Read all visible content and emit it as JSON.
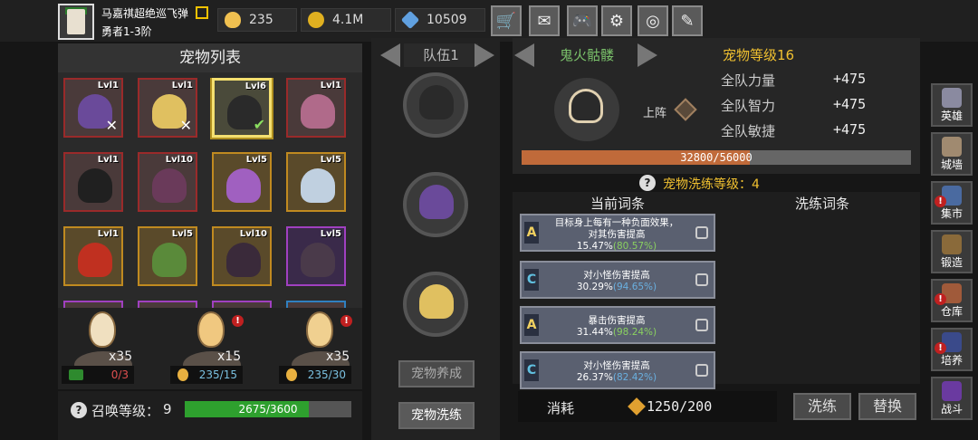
{
  "player": {
    "name": "马嘉祺超绝巡飞弹",
    "rank": "勇者1-3阶"
  },
  "resources": [
    {
      "icon": "egg-icon",
      "value": "235",
      "color": "#f0c050"
    },
    {
      "icon": "coin-icon",
      "value": "4.1M",
      "color": "#e0b020"
    },
    {
      "icon": "gem-icon",
      "value": "10509",
      "color": "#60a0e0"
    }
  ],
  "top_buttons": [
    {
      "name": "shop-icon",
      "glyph": "🛒"
    },
    {
      "name": "mail-icon",
      "glyph": "✉"
    },
    {
      "name": "gamepad-icon",
      "glyph": "🎮"
    },
    {
      "name": "settings-gear-icon",
      "glyph": "⚙"
    },
    {
      "name": "color-wheel-icon",
      "glyph": "◎"
    },
    {
      "name": "feather-icon",
      "glyph": "✎"
    }
  ],
  "pet_list": {
    "title": "宠物列表",
    "pets": [
      {
        "level": "Lvl1",
        "frame": "red",
        "color": "#6a4a9a",
        "mark": "x",
        "selected": false
      },
      {
        "level": "Lvl1",
        "frame": "red",
        "color": "#e0c060",
        "mark": "x",
        "selected": false
      },
      {
        "level": "Lvl6",
        "frame": "gold",
        "color": "#2a2a2a",
        "mark": "check",
        "selected": true
      },
      {
        "level": "Lvl1",
        "frame": "red",
        "color": "#b06a8a",
        "mark": "",
        "selected": false
      },
      {
        "level": "Lvl1",
        "frame": "red",
        "color": "#202020",
        "mark": "",
        "selected": false
      },
      {
        "level": "Lvl10",
        "frame": "red",
        "color": "#6a3a5a",
        "mark": "",
        "selected": false
      },
      {
        "level": "Lvl5",
        "frame": "gold",
        "color": "#a060c0",
        "mark": "",
        "selected": false
      },
      {
        "level": "Lvl5",
        "frame": "gold",
        "color": "#c0d0e0",
        "mark": "",
        "selected": false
      },
      {
        "level": "Lvl1",
        "frame": "gold",
        "color": "#c03020",
        "mark": "",
        "selected": false
      },
      {
        "level": "Lvl5",
        "frame": "gold",
        "color": "#5a8a3a",
        "mark": "",
        "selected": false
      },
      {
        "level": "Lvl10",
        "frame": "gold",
        "color": "#3a2a3a",
        "mark": "",
        "selected": false
      },
      {
        "level": "Lvl5",
        "frame": "purple",
        "color": "#4a3a4a",
        "mark": "",
        "selected": false
      }
    ]
  },
  "eggs": [
    {
      "count": "x35",
      "cost": "0/3",
      "cost_icon": "video-ad-icon",
      "alert": false,
      "color": "#f0e0c0"
    },
    {
      "count": "x15",
      "cost": "235/15",
      "cost_icon": "egg-icon",
      "alert": true,
      "color": "#f0c880"
    },
    {
      "count": "x35",
      "cost": "235/30",
      "cost_icon": "egg-icon",
      "alert": true,
      "color": "#f0d090"
    }
  ],
  "summon": {
    "label": "召唤等级：",
    "level": "9",
    "progress_text": "2675/3600",
    "progress": 0.743
  },
  "team": {
    "title": "队伍1",
    "slots": [
      {
        "name": "team-slot-1",
        "color": "#2a2a2a"
      },
      {
        "name": "team-slot-2",
        "color": "#6a4a9a"
      },
      {
        "name": "team-slot-3",
        "color": "#e0c060"
      }
    ],
    "raise_button": "宠物养成",
    "wash_button": "宠物洗练"
  },
  "detail": {
    "pet_name": "鬼火骷髅",
    "pet_level": "宠物等级16",
    "deploy_label": "上阵",
    "stats": [
      {
        "label": "全队力量",
        "value": "+475"
      },
      {
        "label": "全队智力",
        "value": "+475"
      },
      {
        "label": "全队敏捷",
        "value": "+475"
      }
    ],
    "exp_text": "32800/56000",
    "exp_progress": 0.586
  },
  "wash": {
    "level_text": "宠物洗练等级：4",
    "current_header": "当前词条",
    "wash_header": "洗练词条",
    "affixes": [
      {
        "grade": "A",
        "grade_color": "#f0d060",
        "lines": [
          "目标身上每有一种负面效果，",
          "对其伤害提高"
        ],
        "value": "15.47%",
        "max": "(80.57%)"
      },
      {
        "grade": "C",
        "grade_color": "#60c0e0",
        "lines": [
          "对小怪伤害提高"
        ],
        "value": "30.29%",
        "max": "(94.65%)"
      },
      {
        "grade": "A",
        "grade_color": "#f0d060",
        "lines": [
          "暴击伤害提高"
        ],
        "value": "31.44%",
        "max": "(98.24%)"
      },
      {
        "grade": "C",
        "grade_color": "#60c0e0",
        "lines": [
          "对小怪伤害提高"
        ],
        "value": "26.37%",
        "max": "(82.42%)"
      }
    ],
    "cost_label": "消耗",
    "cost_value": "1250/200",
    "wash_button": "洗练",
    "replace_button": "替换"
  },
  "nav": [
    {
      "label": "英雄",
      "icon": "hero-helmet-icon",
      "color": "#8a8aa0",
      "alert": false
    },
    {
      "label": "城墙",
      "icon": "colosseum-icon",
      "color": "#a08a70",
      "alert": false
    },
    {
      "label": "集市",
      "icon": "market-stall-icon",
      "color": "#4a6aa0",
      "alert": true
    },
    {
      "label": "锻造",
      "icon": "anvil-icon",
      "color": "#8a6a3a",
      "alert": false
    },
    {
      "label": "仓库",
      "icon": "warehouse-chest-icon",
      "color": "#a05a3a",
      "alert": true
    },
    {
      "label": "培养",
      "icon": "training-potion-icon",
      "color": "#3a4a8a",
      "alert": true
    },
    {
      "label": "战斗",
      "icon": "battle-portal-icon",
      "color": "#6a3aa0",
      "alert": false
    }
  ]
}
